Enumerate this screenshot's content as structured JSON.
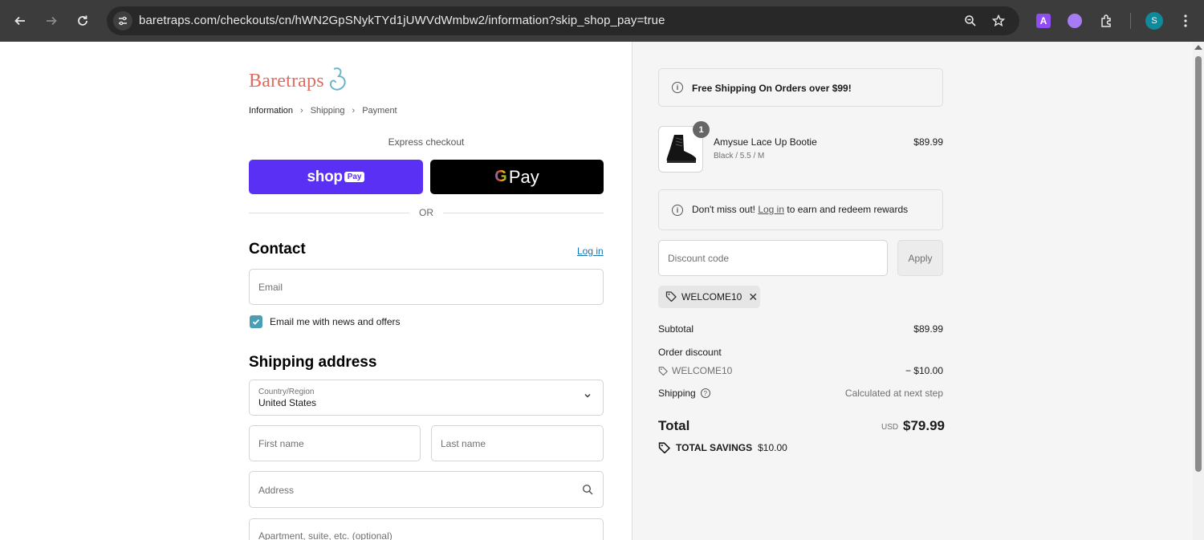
{
  "browser": {
    "url": "baretraps.com/checkouts/cn/hWN2GpSNykTYd1jUWVdWmbw2/information?skip_shop_pay=true",
    "profile_initial": "S",
    "ext_a_label": "A"
  },
  "brand": {
    "logo_text": "Baretraps",
    "logo_mark": "B"
  },
  "breadcrumb": {
    "step1": "Information",
    "step2": "Shipping",
    "step3": "Payment"
  },
  "express": {
    "label": "Express checkout",
    "shop_label": "shop",
    "shop_pay_label": "Pay",
    "gpay_g": "G",
    "gpay_label": "Pay",
    "or_label": "OR"
  },
  "contact": {
    "title": "Contact",
    "login_label": "Log in",
    "email_placeholder": "Email",
    "newsletter_label": "Email me with news and offers",
    "newsletter_checked": true
  },
  "shipping": {
    "title": "Shipping address",
    "country_label": "Country/Region",
    "country_value": "United States",
    "first_name_placeholder": "First name",
    "last_name_placeholder": "Last name",
    "address_placeholder": "Address",
    "apartment_placeholder": "Apartment, suite, etc. (optional)"
  },
  "summary": {
    "free_shipping_notice": "Free Shipping On Orders over $99!",
    "product": {
      "quantity": "1",
      "name": "Amysue Lace Up Bootie",
      "variant": "Black / 5.5 / M",
      "price": "$89.99"
    },
    "rewards": {
      "prefix": "Don't miss out!",
      "link": "Log in",
      "suffix": "to earn and redeem rewards"
    },
    "discount_placeholder": "Discount code",
    "apply_label": "Apply",
    "applied_code": "WELCOME10",
    "subtotal_label": "Subtotal",
    "subtotal_value": "$89.99",
    "order_discount_label": "Order discount",
    "discount_code": "WELCOME10",
    "discount_value": "− $10.00",
    "shipping_label": "Shipping",
    "shipping_value": "Calculated at next step",
    "total_label": "Total",
    "total_currency": "USD",
    "total_value": "$79.99",
    "savings_label": "TOTAL SAVINGS",
    "savings_value": "$10.00"
  },
  "colors": {
    "shop_pay_purple": "#5a31f4",
    "brand_coral": "#e26a5e",
    "brand_teal": "#6ab7c8",
    "link_blue": "#1773b0",
    "checkbox_teal": "#4a9fb5"
  }
}
